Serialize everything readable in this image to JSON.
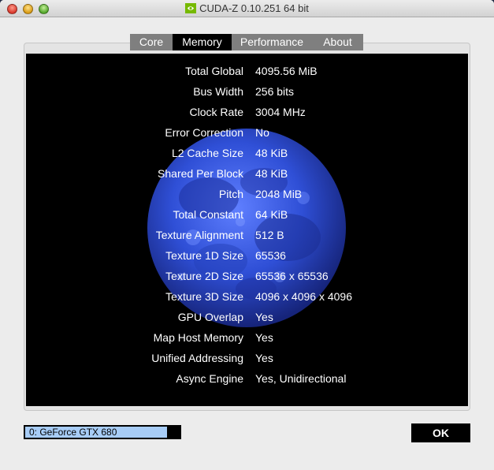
{
  "window": {
    "title": "CUDA-Z 0.10.251 64 bit",
    "app_icon": "nvidia-logo-icon"
  },
  "tabs": [
    {
      "label": "Core",
      "active": false
    },
    {
      "label": "Memory",
      "active": true
    },
    {
      "label": "Performance",
      "active": false
    },
    {
      "label": "About",
      "active": false
    }
  ],
  "memory": {
    "rows": [
      {
        "label": "Total Global",
        "value": "4095.56 MiB"
      },
      {
        "label": "Bus Width",
        "value": "256 bits"
      },
      {
        "label": "Clock Rate",
        "value": "3004 MHz"
      },
      {
        "label": "Error Correction",
        "value": "No"
      },
      {
        "label": "L2 Cache Size",
        "value": "48 KiB"
      },
      {
        "label": "Shared Per Block",
        "value": "48 KiB"
      },
      {
        "label": "Pitch",
        "value": "2048 MiB"
      },
      {
        "label": "Total Constant",
        "value": "64 KiB"
      },
      {
        "label": "Texture Alignment",
        "value": "512 B"
      },
      {
        "label": "Texture 1D Size",
        "value": "65536"
      },
      {
        "label": "Texture 2D Size",
        "value": "65536 x 65536"
      },
      {
        "label": "Texture 3D Size",
        "value": "4096 x 4096 x 4096"
      },
      {
        "label": "GPU Overlap",
        "value": "Yes"
      },
      {
        "label": "Map Host Memory",
        "value": "Yes"
      },
      {
        "label": "Unified Addressing",
        "value": "Yes"
      },
      {
        "label": "Async Engine",
        "value": "Yes, Unidirectional"
      }
    ]
  },
  "device": {
    "selected": "0: GeForce GTX 680"
  },
  "buttons": {
    "ok": "OK"
  },
  "colors": {
    "panel_bg": "#000000",
    "moon_blue": "#2f4fd6",
    "tab_active": "#000000",
    "tab_inactive": "#7f7f7f",
    "device_highlight": "#a7ccf6"
  }
}
